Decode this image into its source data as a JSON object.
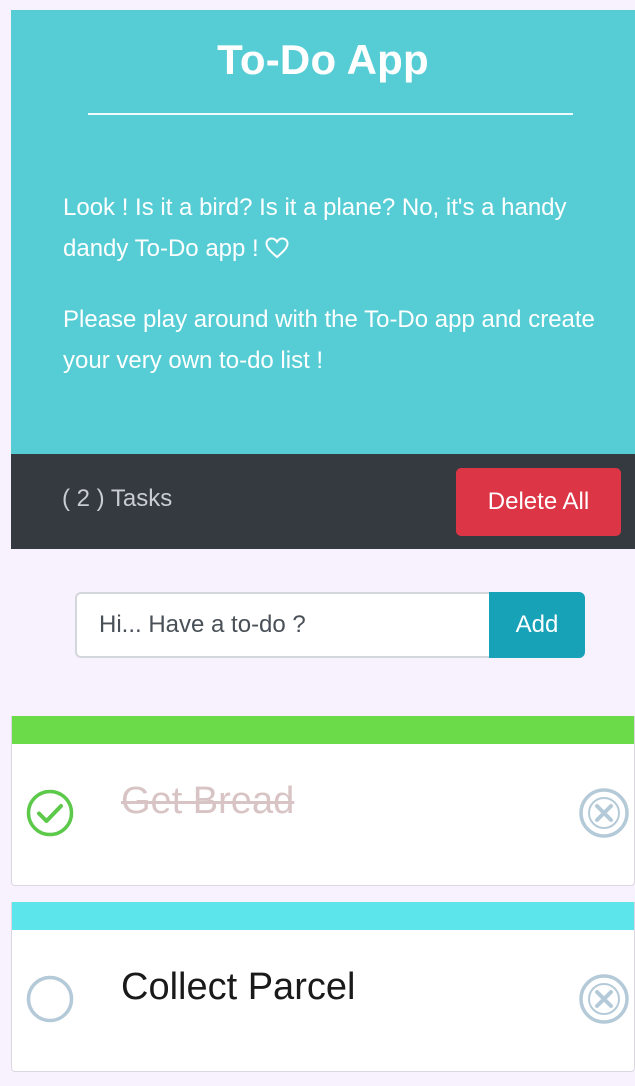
{
  "header": {
    "title": "To-Do App",
    "paragraph1": "Look ! Is it a bird? Is it a plane? No, it's a handy dandy To-Do app !",
    "paragraph1_icon": "heart-outline-icon",
    "paragraph2": "Please play around with the To-Do app and create your very own to-do list !"
  },
  "taskbar": {
    "count_label": "( 2 ) Tasks",
    "delete_all_label": "Delete All"
  },
  "add_form": {
    "placeholder": "Hi... Have a to-do ?",
    "value": "",
    "add_label": "Add"
  },
  "todos": [
    {
      "title": "Get Bread",
      "completed": true,
      "check_icon": "check-circle-icon",
      "remove_icon": "close-circle-icon",
      "strip_color": "#6bdb4a"
    },
    {
      "title": "Collect Parcel",
      "completed": false,
      "check_icon": "empty-circle-icon",
      "remove_icon": "close-circle-icon",
      "strip_color": "#5ce6ec"
    }
  ],
  "colors": {
    "hero_background": "#56cdd5",
    "taskbar_background": "#343a40",
    "delete_button": "#dc3545",
    "add_button": "#17a2b8",
    "page_background": "#f7f2fd",
    "check_green": "#5cc94a",
    "icon_grey_blue": "#b5cad8"
  }
}
